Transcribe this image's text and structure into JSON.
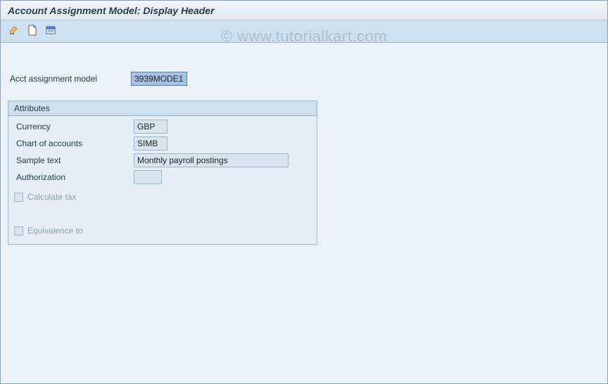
{
  "header": {
    "title": "Account Assignment Model: Display Header"
  },
  "toolbar": {
    "btn1_icon": "change-display-icon",
    "btn2_icon": "document-icon",
    "btn3_icon": "overview-icon"
  },
  "main": {
    "acct_model_label": "Acct assignment model",
    "acct_model_value": "3939MODE1"
  },
  "attributes": {
    "group_title": "Attributes",
    "currency_label": "Currency",
    "currency_value": "GBP",
    "coa_label": "Chart of accounts",
    "coa_value": "SIMB",
    "sample_text_label": "Sample text",
    "sample_text_value": "Monthly payroll postings",
    "authorization_label": "Authorization",
    "authorization_value": "",
    "calculate_tax_label": "Calculate tax",
    "equivalence_label": "Equivalence to"
  },
  "watermark": {
    "text": "© www.tutorialkart.com"
  }
}
